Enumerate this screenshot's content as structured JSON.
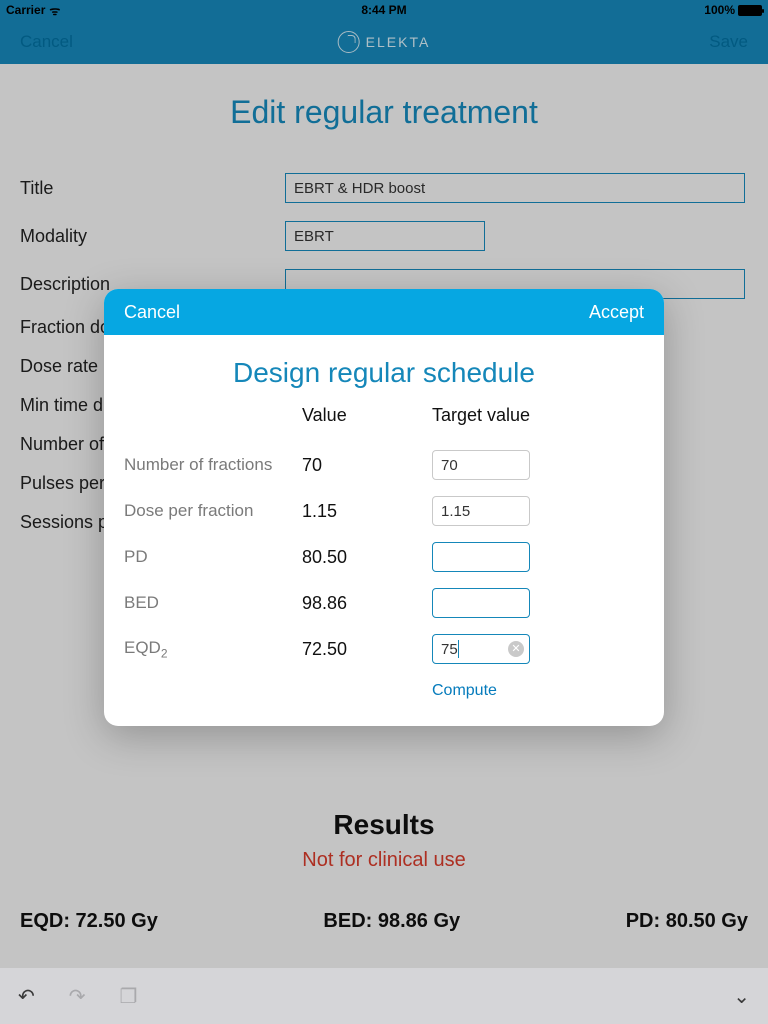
{
  "statusbar": {
    "carrier": "Carrier",
    "time": "8:44 PM",
    "battery": "100%"
  },
  "nav": {
    "cancel": "Cancel",
    "save": "Save",
    "brand": "ELEKTA"
  },
  "page": {
    "title": "Edit regular treatment",
    "labels": {
      "title": "Title",
      "modality": "Modality",
      "description": "Description",
      "fraction_dose": "Fraction dose",
      "dose_rate": "Dose rate [",
      "min_time": "Min time d",
      "number_of": "Number of",
      "pulses": "Pulses per",
      "sessions": "Sessions p"
    },
    "values": {
      "title": "EBRT & HDR boost",
      "modality": "EBRT"
    }
  },
  "modal": {
    "cancel": "Cancel",
    "accept": "Accept",
    "title": "Design regular schedule",
    "head_value": "Value",
    "head_target": "Target value",
    "rows": {
      "fractions": {
        "label": "Number of fractions",
        "value": "70",
        "target": "70"
      },
      "dose_per_fraction": {
        "label": "Dose per fraction",
        "value": "1.15",
        "target": "1.15"
      },
      "pd": {
        "label": "PD",
        "value": "80.50",
        "target": ""
      },
      "bed": {
        "label": "BED",
        "value": "98.86",
        "target": ""
      },
      "eqd2": {
        "label_pre": "EQD",
        "label_sub": "2",
        "value": "72.50",
        "target": "75"
      }
    },
    "compute": "Compute"
  },
  "results": {
    "title": "Results",
    "warn": "Not for clinical use",
    "eqd": "EQD: 72.50 Gy",
    "bed": "BED: 98.86 Gy",
    "pd": "PD: 80.50 Gy"
  }
}
